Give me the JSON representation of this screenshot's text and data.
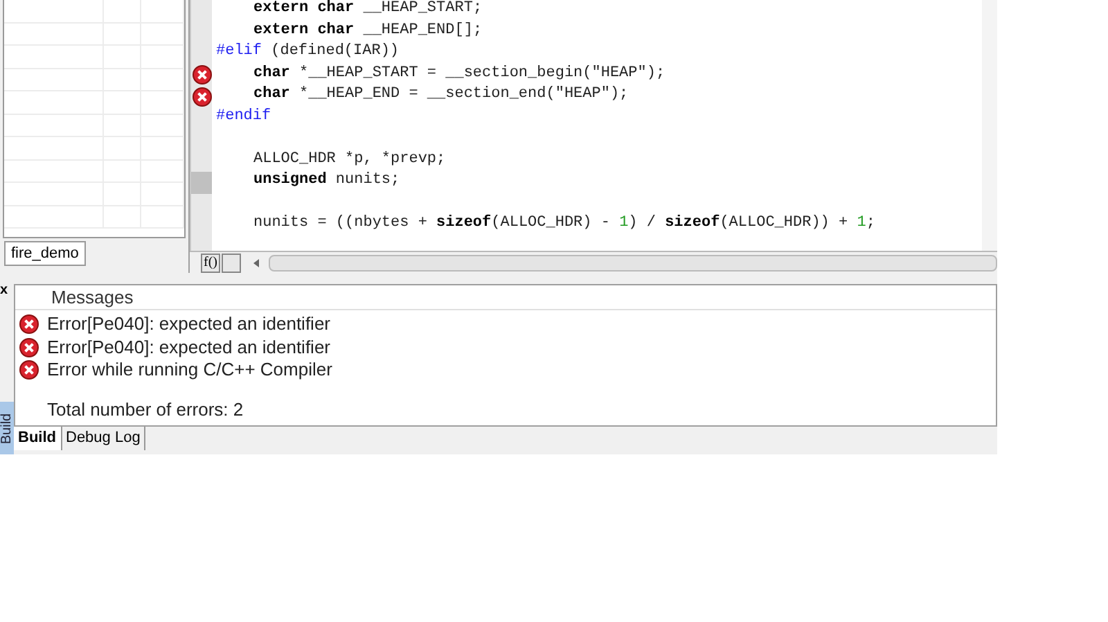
{
  "workspace": {
    "tabs": [
      {
        "label": "fire_demo",
        "selected": true
      }
    ]
  },
  "editor": {
    "lines": [
      {
        "error": false,
        "marked": false,
        "kind": "code",
        "parts": [
          {
            "text": "extern char",
            "kind": "keyword"
          },
          {
            "text": " __HEAP_START;",
            "kind": "plain"
          }
        ]
      },
      {
        "error": false,
        "marked": false,
        "kind": "code",
        "parts": [
          {
            "text": "extern char",
            "kind": "keyword"
          },
          {
            "text": " __HEAP_END[];",
            "kind": "plain"
          }
        ]
      },
      {
        "error": false,
        "marked": false,
        "kind": "preprocessor",
        "parts": [
          {
            "text": "#elif",
            "kind": "directive"
          },
          {
            "text": " (defined(IAR))",
            "kind": "plain"
          }
        ]
      },
      {
        "error": true,
        "marked": false,
        "kind": "code",
        "parts": [
          {
            "text": "char",
            "kind": "keyword"
          },
          {
            "text": " *__HEAP_START = __section_begin(\"HEAP\");",
            "kind": "plain"
          }
        ]
      },
      {
        "error": true,
        "marked": false,
        "kind": "code",
        "parts": [
          {
            "text": "char",
            "kind": "keyword"
          },
          {
            "text": " *__HEAP_END = __section_end(\"HEAP\");",
            "kind": "plain"
          }
        ]
      },
      {
        "error": false,
        "marked": false,
        "kind": "preprocessor",
        "parts": [
          {
            "text": "#endif",
            "kind": "directive"
          }
        ]
      },
      {
        "kind": "blank"
      },
      {
        "error": false,
        "marked": false,
        "kind": "code",
        "parts": [
          {
            "text": "ALLOC_HDR *p, *prevp;",
            "kind": "plain"
          }
        ]
      },
      {
        "error": false,
        "marked": true,
        "kind": "code",
        "parts": [
          {
            "text": "unsigned",
            "kind": "keyword"
          },
          {
            "text": " nunits;",
            "kind": "plain"
          }
        ]
      },
      {
        "kind": "blank"
      },
      {
        "error": false,
        "marked": false,
        "kind": "code",
        "parts": [
          {
            "text": "nunits = ((nbytes + ",
            "kind": "plain"
          },
          {
            "text": "sizeof",
            "kind": "keyword"
          },
          {
            "text": "(ALLOC_HDR) - ",
            "kind": "plain"
          },
          {
            "text": "1",
            "kind": "number"
          },
          {
            "text": ") / ",
            "kind": "plain"
          },
          {
            "text": "sizeof",
            "kind": "keyword"
          },
          {
            "text": "(ALLOC_HDR)) + ",
            "kind": "plain"
          },
          {
            "text": "1",
            "kind": "number"
          },
          {
            "text": ";",
            "kind": "plain"
          }
        ]
      }
    ],
    "function_button": "f()"
  },
  "messages": {
    "close": "x",
    "side_tab": "Build",
    "column": "Messages",
    "rows": [
      {
        "kind": "error",
        "text": "Error[Pe040]: expected an identifier"
      },
      {
        "kind": "error",
        "text": "Error[Pe040]: expected an identifier"
      },
      {
        "kind": "error",
        "text": "Error while running C/C++ Compiler"
      },
      {
        "kind": "blank"
      },
      {
        "kind": "info",
        "text": "Total number of errors: 2"
      }
    ],
    "tabs": [
      {
        "label": "Build",
        "selected": true
      },
      {
        "label": "Debug Log",
        "selected": false
      }
    ]
  }
}
